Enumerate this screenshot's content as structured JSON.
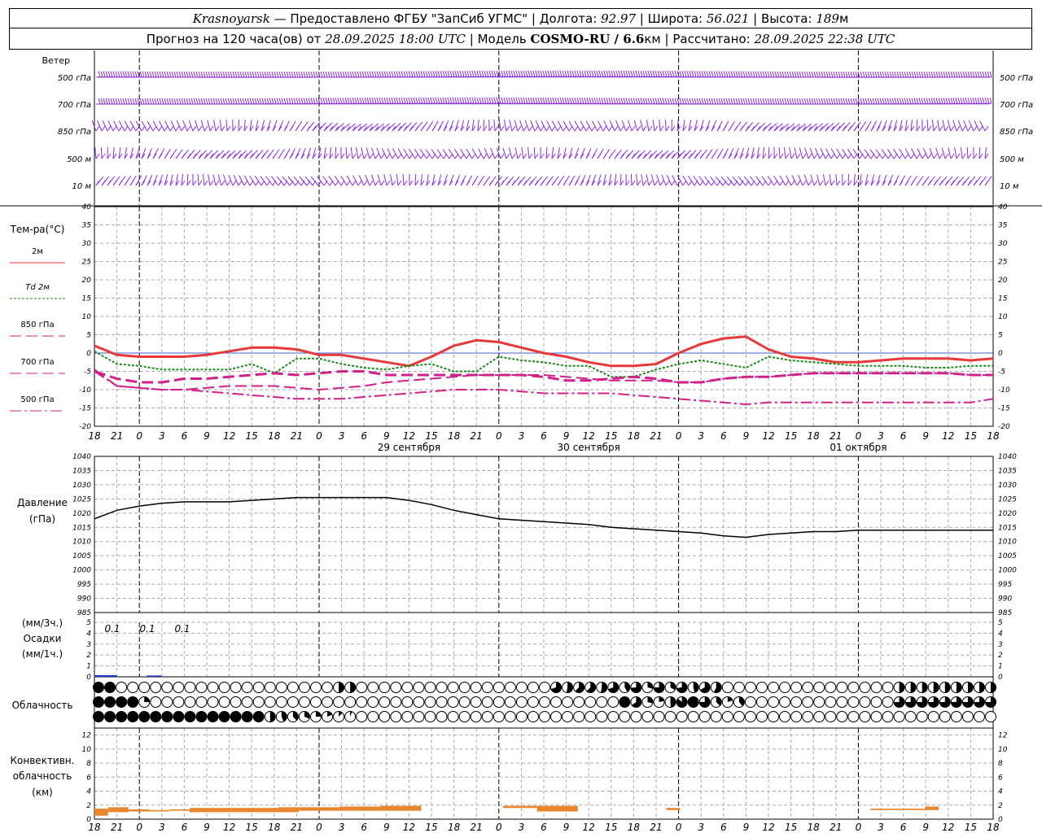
{
  "header": {
    "city": "Krasnoyarsk",
    "provider": "— Предоставлено ФГБУ \"ЗапСиб УГМС\"",
    "lon_label": "| Долгота:",
    "lon": "92.97",
    "lat_label": "| Широта:",
    "lat": "56.021",
    "alt_label": "| Высота:",
    "alt": "189",
    "alt_unit": "м",
    "forecast_label": "Прогноз на 120 часа(ов) от",
    "forecast_from": "28.09.2025 18:00 UTC",
    "model_label": "| Модель",
    "model": "COSMO-RU / 6.6",
    "model_unit": "км",
    "computed_label": "| Рассчитано:",
    "computed": "28.09.2025 22:38 UTC"
  },
  "colors": {
    "t2m": "#e8383a",
    "td2m": "#1a8a1a",
    "t850": "#d0208a",
    "t700": "#d0208a",
    "t500": "#d0208a",
    "wind": "#8a2be2",
    "pressure": "#000000",
    "precip": "#2233cc",
    "conv": "#e8862e",
    "grid": "#aaaaaa"
  },
  "chart_data": [
    {
      "type": "wind_barbs",
      "title": "Ветер",
      "levels": [
        "500 гПа",
        "700 гПа",
        "850 гПа",
        "500 м",
        "10 м"
      ]
    },
    {
      "type": "line",
      "title": "Тем-ра(°C)",
      "ylim": [
        -20,
        40
      ],
      "yticks": [
        -20,
        -15,
        -10,
        -5,
        0,
        5,
        10,
        15,
        20,
        25,
        30,
        35,
        40
      ],
      "x_hours": [
        0,
        3,
        6,
        9,
        12,
        15,
        18,
        21,
        24,
        27,
        30,
        33,
        36,
        39,
        42,
        45,
        48,
        51,
        54,
        57,
        60,
        63,
        66,
        69,
        72,
        75,
        78,
        81,
        84,
        87,
        90,
        93,
        96,
        99,
        102,
        105,
        108,
        111,
        114,
        117,
        120
      ],
      "x_tick_labels": [
        "18",
        "21",
        "0",
        "3",
        "6",
        "9",
        "12",
        "15",
        "18",
        "21",
        "0",
        "3",
        "6",
        "9",
        "12",
        "15",
        "18",
        "21",
        "0",
        "3",
        "6",
        "9",
        "12",
        "15",
        "18",
        "21",
        "0",
        "3",
        "6",
        "9",
        "12",
        "15",
        "18",
        "21",
        "0",
        "3",
        "6",
        "9",
        "12",
        "15",
        "18",
        "21",
        "0"
      ],
      "day_labels": [
        {
          "hour": 42,
          "text": "29 сентября"
        },
        {
          "hour": 66,
          "text": "30 сентября"
        },
        {
          "hour": 102,
          "text": "01 октября"
        }
      ],
      "series": [
        {
          "name": "2м",
          "values": [
            2,
            -0.5,
            -1,
            -1,
            -1,
            -0.5,
            0.5,
            1.5,
            1.5,
            1,
            -0.5,
            -0.5,
            -1.5,
            -2.5,
            -3.5,
            -1,
            2,
            3.5,
            3,
            1.5,
            0,
            -1,
            -2.5,
            -3.5,
            -3.5,
            -3,
            0,
            2.5,
            4,
            4.5,
            1,
            -1,
            -1.5,
            -2.5,
            -2.5,
            -2,
            -1.5,
            -1.5,
            -1.5,
            -2,
            -1.5
          ]
        },
        {
          "name": "Td 2м",
          "values": [
            0.5,
            -3,
            -3.5,
            -4.5,
            -4.5,
            -4.5,
            -4.5,
            -3,
            -5.5,
            -1.5,
            -1.5,
            -3,
            -4,
            -4.5,
            -3.5,
            -3,
            -5,
            -5,
            -1,
            -2,
            -2.5,
            -3.5,
            -3.5,
            -6.5,
            -6.5,
            -4.5,
            -3,
            -2,
            -3,
            -4,
            -1,
            -2,
            -2.5,
            -3,
            -3.5,
            -3.5,
            -3.5,
            -4,
            -4,
            -3.5,
            -3.5
          ]
        },
        {
          "name": "850 гПа",
          "values": [
            -5,
            -7,
            -8,
            -8,
            -7,
            -7,
            -6.5,
            -6,
            -5.5,
            -6,
            -5.5,
            -5,
            -5,
            -6,
            -6,
            -6,
            -6,
            -6,
            -6,
            -6,
            -6.5,
            -7.5,
            -7.5,
            -7,
            -6.5,
            -7,
            -8,
            -8,
            -7,
            -6.5,
            -6.5,
            -6,
            -5.5,
            -5.5,
            -5.5,
            -5.5,
            -5.5,
            -5.5,
            -5.5,
            -6,
            -6
          ]
        },
        {
          "name": "700 гПа",
          "values": [
            -4.5,
            -9,
            -9.5,
            -10,
            -10,
            -9.5,
            -9,
            -9,
            -9,
            -9.5,
            -10,
            -9.5,
            -9,
            -8,
            -7.5,
            -7,
            -6.5,
            -6,
            -6,
            -6,
            -6,
            -6.5,
            -7,
            -7.5,
            -7.5,
            -7.5,
            -8,
            -8,
            -7,
            -6.5,
            -6.5,
            -6,
            -5.5,
            -5.5,
            -5.5,
            -5.5,
            -5.5,
            -5.5,
            -5.5,
            -6,
            -6
          ]
        },
        {
          "name": "500 гПа",
          "values": [
            -5,
            -9,
            -9.5,
            -10,
            -10,
            -10.5,
            -11,
            -11.5,
            -12,
            -12.5,
            -12.5,
            -12.5,
            -12,
            -11.5,
            -11,
            -10.5,
            -10,
            -10,
            -10,
            -10.5,
            -11,
            -11,
            -11,
            -11,
            -11.5,
            -12,
            -12.5,
            -13,
            -13.5,
            -14,
            -13.5,
            -13.5,
            -13.5,
            -13.5,
            -13.5,
            -13.5,
            -13.5,
            -13.5,
            -13.5,
            -13.5,
            -12.5
          ]
        }
      ]
    },
    {
      "type": "line",
      "title": "Давление",
      "ylabel": "(гПа)",
      "ylim": [
        985,
        1040
      ],
      "yticks": [
        985,
        990,
        995,
        1000,
        1005,
        1010,
        1015,
        1020,
        1025,
        1030,
        1035,
        1040
      ],
      "series": [
        {
          "name": "Давление",
          "values": [
            1018,
            1021,
            1022.5,
            1023.5,
            1024,
            1024,
            1024,
            1024.5,
            1025,
            1025.5,
            1025.5,
            1025.5,
            1025.5,
            1025.5,
            1024.5,
            1023,
            1021,
            1019.5,
            1018,
            1017.5,
            1017,
            1016.5,
            1016,
            1015,
            1014.5,
            1014,
            1013.5,
            1013,
            1012,
            1011.5,
            1012.5,
            1013,
            1013.5,
            1013.5,
            1014,
            1014,
            1014,
            1014,
            1014,
            1014,
            1014
          ]
        }
      ]
    },
    {
      "type": "bar",
      "title": "Осадки",
      "ylabel_top": "(мм/3ч.)",
      "ylabel_bottom": "(мм/1ч.)",
      "ylim": [
        0,
        5
      ],
      "yticks": [
        0,
        1,
        2,
        3,
        4,
        5
      ],
      "labels": [
        {
          "hour": 3,
          "text": "0.1"
        },
        {
          "hour": 15,
          "text": "0.1"
        },
        {
          "hour": 27,
          "text": "0.1"
        }
      ],
      "bars": [
        {
          "hour": 0,
          "value": 0.15
        },
        {
          "hour": 3,
          "value": 0.15
        },
        {
          "hour": 6,
          "value": 0.15
        },
        {
          "hour": 21,
          "value": 0.12
        },
        {
          "hour": 24,
          "value": 0.12
        }
      ]
    },
    {
      "type": "table",
      "title": "Облачность",
      "rows_fraction_description": "three layers of cloud cover symbols, hourly, value 0..1 per cell"
    },
    {
      "type": "bar",
      "title": "Конвективн. облачность (км)",
      "ylim": [
        0,
        13
      ],
      "yticks": [
        0,
        2,
        4,
        6,
        8,
        10,
        12
      ],
      "segments": [
        {
          "from": 0,
          "to": 2,
          "bottom": 0.5,
          "top": 1.5
        },
        {
          "from": 2,
          "to": 5,
          "bottom": 1.0,
          "top": 1.7
        },
        {
          "from": 5,
          "to": 8,
          "bottom": 1.1,
          "top": 1.4
        },
        {
          "from": 8,
          "to": 11,
          "bottom": 1.1,
          "top": 1.3
        },
        {
          "from": 11,
          "to": 14,
          "bottom": 1.2,
          "top": 1.4
        },
        {
          "from": 14,
          "to": 20,
          "bottom": 1.0,
          "top": 1.6
        },
        {
          "from": 20,
          "to": 27,
          "bottom": 1.0,
          "top": 1.6
        },
        {
          "from": 27,
          "to": 30,
          "bottom": 1.0,
          "top": 1.7
        },
        {
          "from": 30,
          "to": 36,
          "bottom": 1.2,
          "top": 1.7
        },
        {
          "from": 36,
          "to": 42,
          "bottom": 1.2,
          "top": 1.8
        },
        {
          "from": 42,
          "to": 48,
          "bottom": 1.2,
          "top": 1.9
        },
        {
          "from": 60,
          "to": 65,
          "bottom": 1.6,
          "top": 1.9
        },
        {
          "from": 65,
          "to": 71,
          "bottom": 1.1,
          "top": 1.9
        },
        {
          "from": 84,
          "to": 86,
          "bottom": 1.3,
          "top": 1.6
        },
        {
          "from": 114,
          "to": 122,
          "bottom": 1.3,
          "top": 1.5
        },
        {
          "from": 122,
          "to": 124,
          "bottom": 1.3,
          "top": 1.8
        }
      ]
    }
  ]
}
